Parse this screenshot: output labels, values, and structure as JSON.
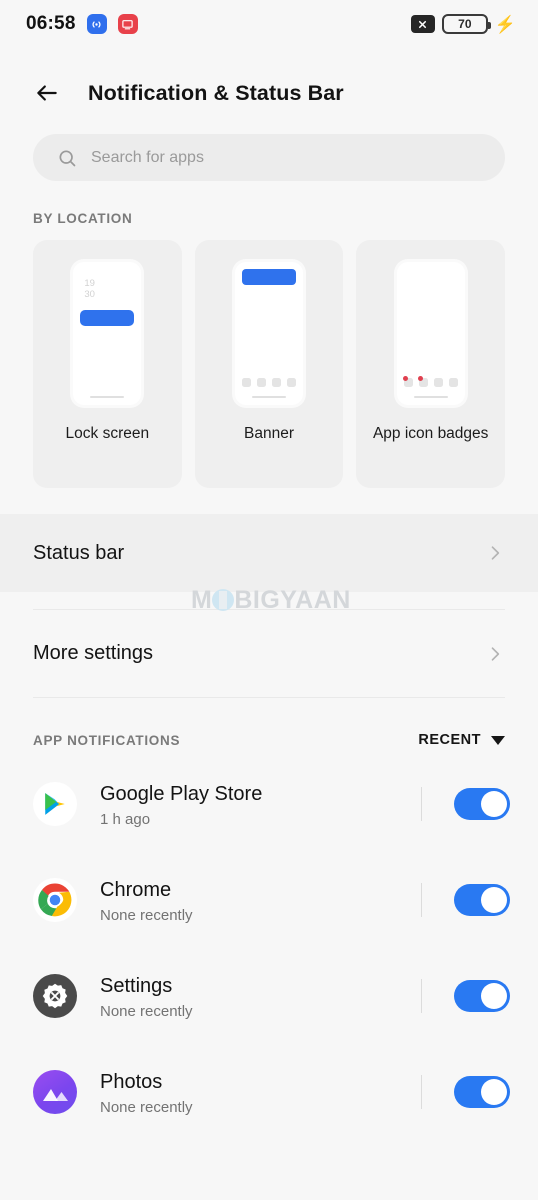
{
  "statusbar": {
    "time": "06:58",
    "left_icons": [
      {
        "name": "broadcast-icon",
        "color": "#2f6fed"
      },
      {
        "name": "screencast-icon",
        "color": "#e8414a"
      }
    ],
    "no_sim_icon": "x-icon",
    "battery_level": "70",
    "charging_icon": "bolt-icon"
  },
  "appbar": {
    "back_icon": "back-arrow-icon",
    "title": "Notification & Status Bar"
  },
  "search": {
    "icon": "search-icon",
    "placeholder": "Search for apps",
    "value": ""
  },
  "by_location": {
    "label": "BY LOCATION",
    "cards": [
      {
        "label": "Lock screen",
        "preview": "lockscreen-preview",
        "clock_line1": "19",
        "clock_line2": "30"
      },
      {
        "label": "Banner",
        "preview": "banner-preview"
      },
      {
        "label": "App icon badges",
        "preview": "badges-preview"
      }
    ]
  },
  "settings_rows": [
    {
      "label": "Status bar",
      "chevron": "chevron-right-icon",
      "highlighted": true
    },
    {
      "label": "More settings",
      "chevron": "chevron-right-icon",
      "highlighted": false
    }
  ],
  "watermark": {
    "text_before": "M",
    "text_after": "BIGYAAN",
    "color": "#d4d7da"
  },
  "app_notifications": {
    "label": "APP NOTIFICATIONS",
    "sort_label": "RECENT",
    "sort_icon": "caret-down-icon",
    "apps": [
      {
        "name": "Google Play Store",
        "sub": "1 h ago",
        "icon": "google-play-icon",
        "toggle": "on"
      },
      {
        "name": "Chrome",
        "sub": "None recently",
        "icon": "chrome-icon",
        "toggle": "on"
      },
      {
        "name": "Settings",
        "sub": "None recently",
        "icon": "settings-gear-icon",
        "toggle": "on"
      },
      {
        "name": "Photos",
        "sub": "None recently",
        "icon": "google-photos-icon",
        "toggle": "on"
      }
    ]
  },
  "colors": {
    "accent_blue": "#2979f2",
    "preview_blue": "#2f72ed",
    "badge_red": "#e0404f",
    "page_bg": "#f7f7f7"
  }
}
